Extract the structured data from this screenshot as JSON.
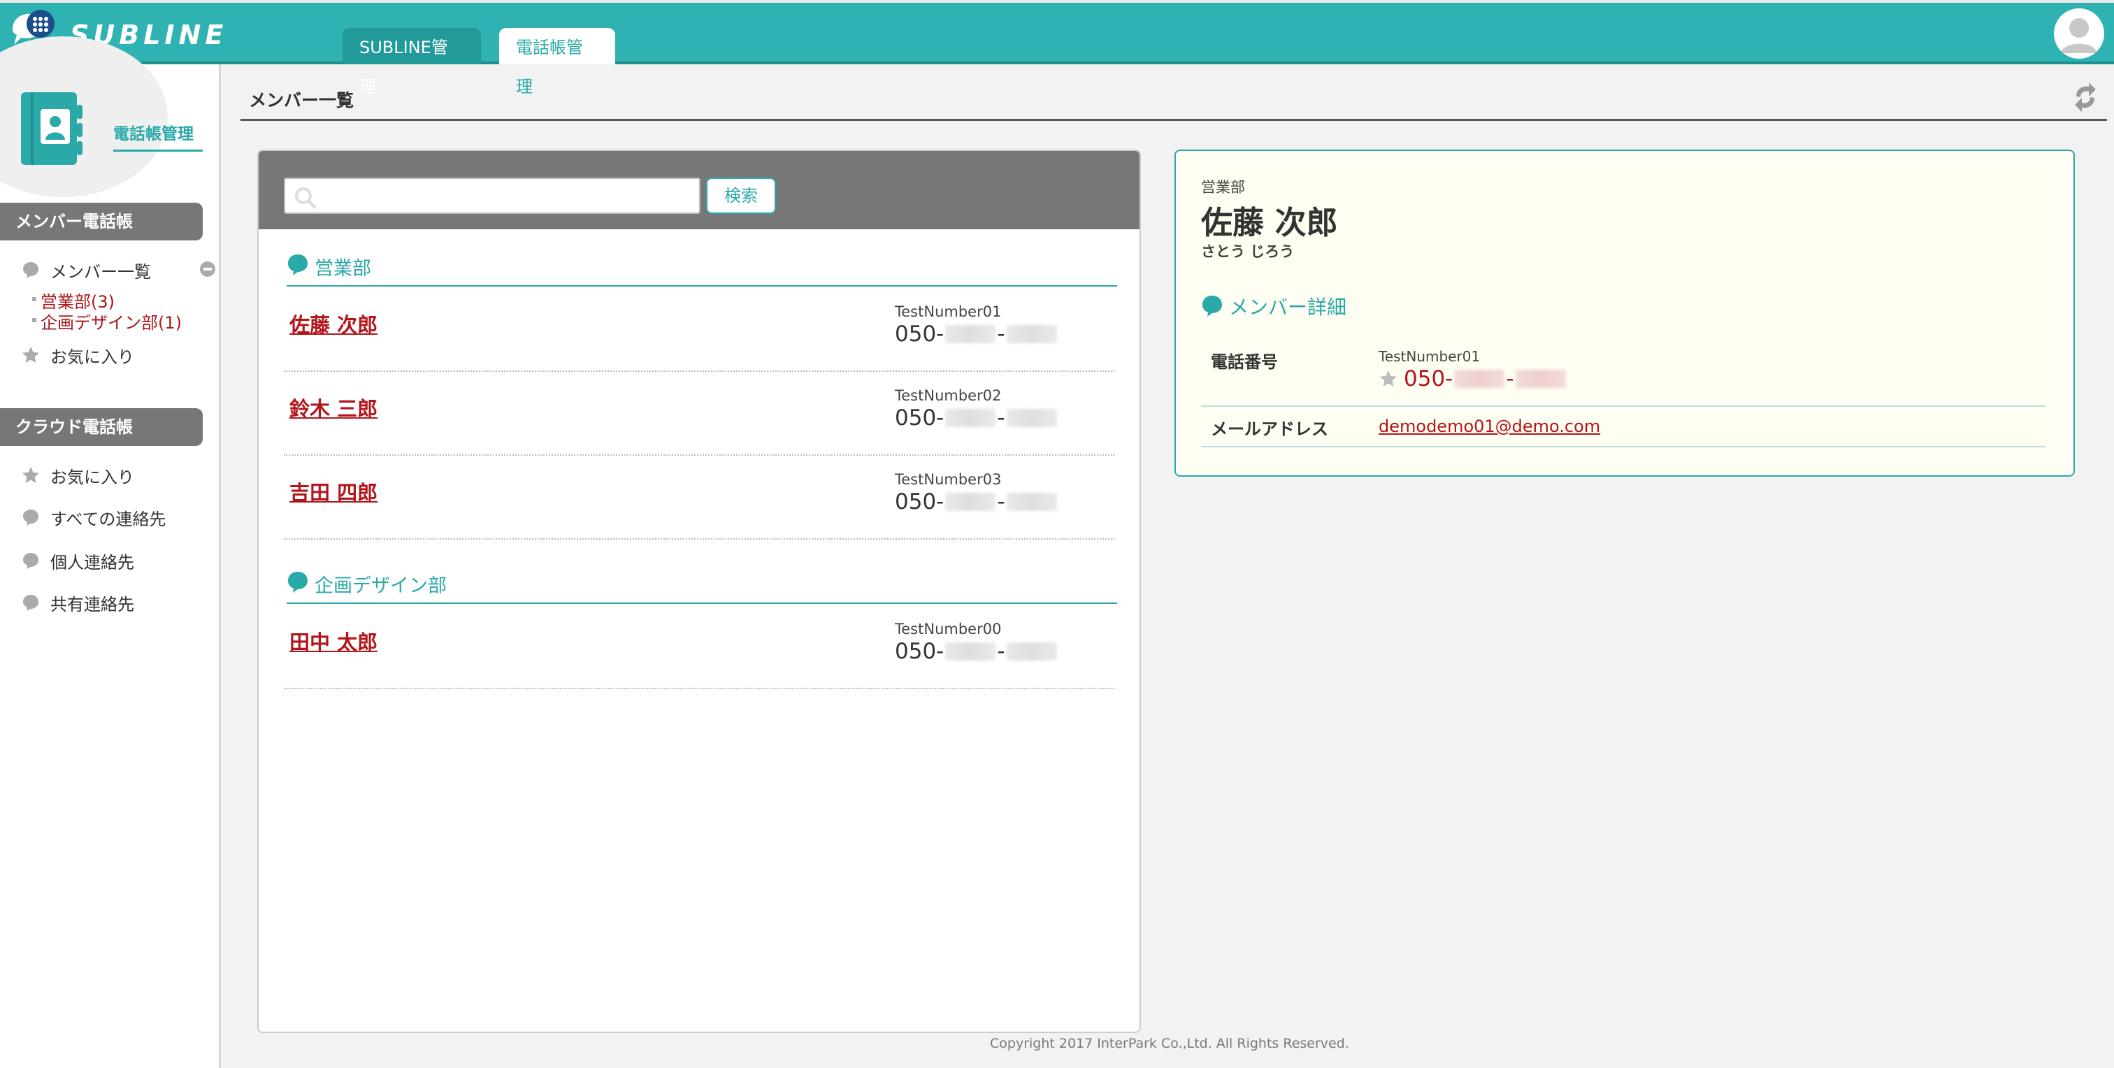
{
  "app": {
    "logo_text": "SUBLINE",
    "tabs": [
      {
        "label": "SUBLINE管理",
        "active": false
      },
      {
        "label": "電話帳管理",
        "active": true
      }
    ],
    "accent_color": "#2fb2b2",
    "link_color": "#b3151b"
  },
  "sidebar": {
    "title": "電話帳管理",
    "member_section": "メンバー電話帳",
    "member_items": [
      {
        "label": "メンバー一覧",
        "icon": "speech-bubble-icon"
      },
      {
        "label": "お気に入り",
        "icon": "star-icon"
      }
    ],
    "sub_items": [
      "営業部(3)",
      "企画デザイン部(1)"
    ],
    "cloud_section": "クラウド電話帳",
    "cloud_items": [
      {
        "label": "お気に入り",
        "icon": "star-icon"
      },
      {
        "label": "すべての連絡先",
        "icon": "speech-bubble-icon"
      },
      {
        "label": "個人連絡先",
        "icon": "speech-bubble-icon"
      },
      {
        "label": "共有連絡先",
        "icon": "speech-bubble-icon"
      }
    ]
  },
  "main": {
    "page_title": "メンバー一覧",
    "search": {
      "placeholder": "",
      "value": "",
      "button_label": "検索"
    },
    "groups": [
      {
        "name": "営業部",
        "members": [
          {
            "name": "佐藤 次郎",
            "phone_label": "TestNumber01",
            "phone_prefix": "050-",
            "phone_sep": "-"
          },
          {
            "name": "鈴木 三郎",
            "phone_label": "TestNumber02",
            "phone_prefix": "050-",
            "phone_sep": "-"
          },
          {
            "name": "吉田 四郎",
            "phone_label": "TestNumber03",
            "phone_prefix": "050-",
            "phone_sep": "-"
          }
        ]
      },
      {
        "name": "企画デザイン部",
        "members": [
          {
            "name": "田中 太郎",
            "phone_label": "TestNumber00",
            "phone_prefix": "050-",
            "phone_sep": "-"
          }
        ]
      }
    ]
  },
  "detail": {
    "department": "営業部",
    "name": "佐藤 次郎",
    "kana": "さとう じろう",
    "section_title": "メンバー詳細",
    "phone_field_label": "電話番号",
    "phone_label": "TestNumber01",
    "phone_prefix": "050-",
    "phone_sep": "-",
    "email_field_label": "メールアドレス",
    "email": "demodemo01@demo.com"
  },
  "footer": {
    "copyright": "Copyright 2017 InterPark Co.,Ltd. All Rights Reserved."
  }
}
